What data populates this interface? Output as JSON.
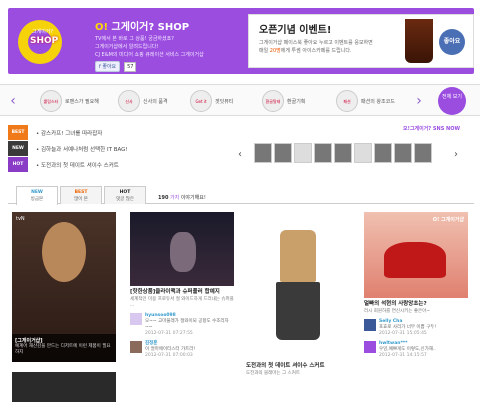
{
  "header": {
    "logo_small": "그게이거?",
    "logo_text": "SHOP",
    "brand_title": "그게이거? SHOP",
    "brand_title_prefix": "O!",
    "brand_desc_1": "TV에서 본 바로 그 상품! 궁금하셨죠?",
    "brand_desc_2": "그게이거샵에서 알려드립니다!",
    "brand_desc_3": "CJ E&M의 미디어 쇼핑 큐레이션 서비스 그게이거샵",
    "fb_like": "좋아요",
    "fb_count": "57"
  },
  "promo": {
    "title": "오픈기념 이벤트!",
    "sub_1": "그게이거샵 페이스북 좋아요 누르고 이벤트를 응모하면",
    "sub_2_prefix": "매일 ",
    "sub_2_emph": "20명",
    "sub_2_suffix": "에게 투썸 아이스카페를 드립니다.",
    "like_label": "좋아요"
  },
  "channels": [
    {
      "logo": "롤링스타",
      "label": "로맨스가 필요해"
    },
    {
      "logo": "신사",
      "label": "신사의 품격"
    },
    {
      "logo": "Get it beaut",
      "label": "겟잇뷰티"
    },
    {
      "logo": "환골탈태",
      "label": "환골기획"
    },
    {
      "logo": "패션",
      "label": "패션의 왕조코드"
    }
  ],
  "channels_all": "전체 보기",
  "tags": [
    {
      "badge": "BEST",
      "color": "#f07a1a",
      "text": "감스카프! 그녀를 따라잡자"
    },
    {
      "badge": "NEW",
      "color": "#3a3a3a",
      "text": "김하늘과 서예나처럼 선택한 IT BAG!"
    },
    {
      "badge": "HOT",
      "color": "#8a3cc7",
      "text": "도전과의 첫 데이트 셔이수 스커트"
    }
  ],
  "sns": {
    "title": "오!그게이거? SNS NOW"
  },
  "tabs": [
    {
      "t1": "NEW",
      "t2": "방금본"
    },
    {
      "t1": "BEST",
      "t2": "많이 본"
    },
    {
      "t1": "HOT",
      "t2": "댓글 많은"
    }
  ],
  "tab_count": {
    "n": "190",
    "p": "가지",
    "rest": "이야기해요!"
  },
  "cards": [
    {
      "img_label": "tvN",
      "title": "[그게이거샵]",
      "desc": "예계어 재산감을 만드는 디저트에 이런 제품이 필요하지"
    },
    {
      "title": "[핫한상품]클라이맥과 슈퍼플러 합예지",
      "desc": "세계적인 미용 프로듀서 절 와이드하게 드러내는 슈퍼플 ...",
      "comments": [
        {
          "name": "hyunsoo098",
          "text": "오~~ 고마울래가 절와이되 공항도 수조리자~~",
          "date": "2012-07-31 07:27:55"
        },
        {
          "name": "김정훈",
          "text": "이 얼마에이터스터 가트라!",
          "date": "2012-07-31 07:00:03"
        }
      ]
    },
    {
      "title": "도전과의 첫 데이트 셔이수 스커트",
      "desc": "도전과의 블래마는 그 스커트"
    },
    {
      "img_label": "O! 그게이거샵",
      "title": "얼빠의 석현의 사랑앙초는?",
      "desc": "러시 회원하를 연신시키는 좋은아~",
      "comments": [
        {
          "name": "Selly Cha",
          "text": "포효로 사리가 너무 이쁨 구두!",
          "date": "2012-07-31 15:05:45"
        },
        {
          "name": "hwltwan***",
          "text": "우잉,예쁘게도 이렇도,신가해..",
          "date": "2012-07-31 14:15:57"
        }
      ]
    }
  ]
}
